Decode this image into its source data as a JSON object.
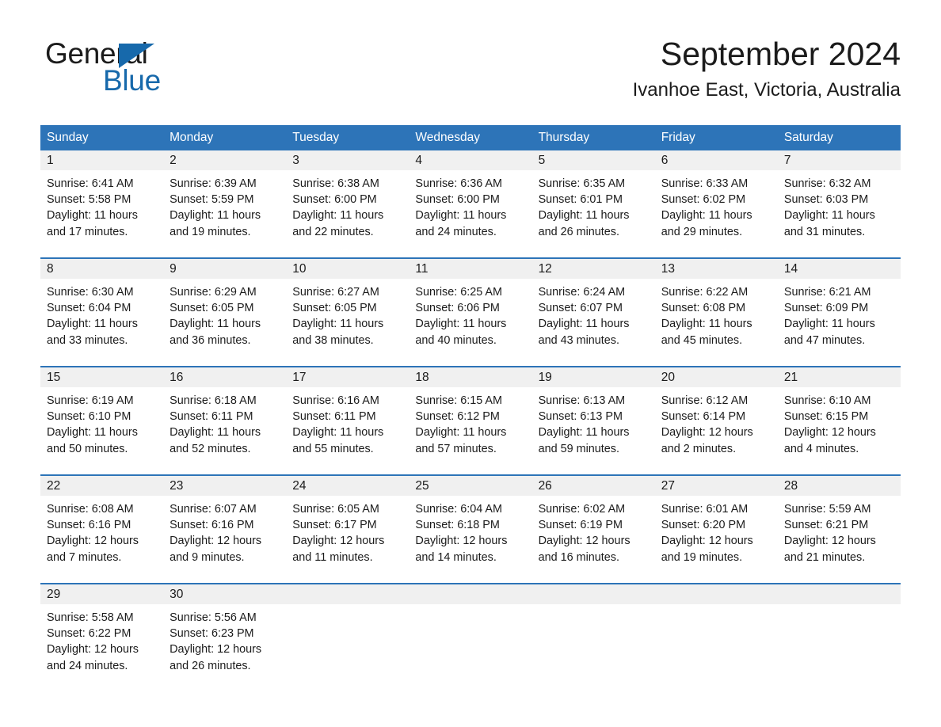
{
  "brand": {
    "name_part1": "General",
    "name_part2": "Blue",
    "triangle_icon": "triangle-logo-icon",
    "accent_color": "#1769ab"
  },
  "header": {
    "title": "September 2024",
    "subtitle": "Ivanhoe East, Victoria, Australia"
  },
  "calendar": {
    "header_color": "#2d74b8",
    "day_number_band_color": "#f0f0f0",
    "weekdays": [
      "Sunday",
      "Monday",
      "Tuesday",
      "Wednesday",
      "Thursday",
      "Friday",
      "Saturday"
    ],
    "weeks": [
      [
        {
          "day": "1",
          "sunrise": "Sunrise: 6:41 AM",
          "sunset": "Sunset: 5:58 PM",
          "daylight": "Daylight: 11 hours and 17 minutes."
        },
        {
          "day": "2",
          "sunrise": "Sunrise: 6:39 AM",
          "sunset": "Sunset: 5:59 PM",
          "daylight": "Daylight: 11 hours and 19 minutes."
        },
        {
          "day": "3",
          "sunrise": "Sunrise: 6:38 AM",
          "sunset": "Sunset: 6:00 PM",
          "daylight": "Daylight: 11 hours and 22 minutes."
        },
        {
          "day": "4",
          "sunrise": "Sunrise: 6:36 AM",
          "sunset": "Sunset: 6:00 PM",
          "daylight": "Daylight: 11 hours and 24 minutes."
        },
        {
          "day": "5",
          "sunrise": "Sunrise: 6:35 AM",
          "sunset": "Sunset: 6:01 PM",
          "daylight": "Daylight: 11 hours and 26 minutes."
        },
        {
          "day": "6",
          "sunrise": "Sunrise: 6:33 AM",
          "sunset": "Sunset: 6:02 PM",
          "daylight": "Daylight: 11 hours and 29 minutes."
        },
        {
          "day": "7",
          "sunrise": "Sunrise: 6:32 AM",
          "sunset": "Sunset: 6:03 PM",
          "daylight": "Daylight: 11 hours and 31 minutes."
        }
      ],
      [
        {
          "day": "8",
          "sunrise": "Sunrise: 6:30 AM",
          "sunset": "Sunset: 6:04 PM",
          "daylight": "Daylight: 11 hours and 33 minutes."
        },
        {
          "day": "9",
          "sunrise": "Sunrise: 6:29 AM",
          "sunset": "Sunset: 6:05 PM",
          "daylight": "Daylight: 11 hours and 36 minutes."
        },
        {
          "day": "10",
          "sunrise": "Sunrise: 6:27 AM",
          "sunset": "Sunset: 6:05 PM",
          "daylight": "Daylight: 11 hours and 38 minutes."
        },
        {
          "day": "11",
          "sunrise": "Sunrise: 6:25 AM",
          "sunset": "Sunset: 6:06 PM",
          "daylight": "Daylight: 11 hours and 40 minutes."
        },
        {
          "day": "12",
          "sunrise": "Sunrise: 6:24 AM",
          "sunset": "Sunset: 6:07 PM",
          "daylight": "Daylight: 11 hours and 43 minutes."
        },
        {
          "day": "13",
          "sunrise": "Sunrise: 6:22 AM",
          "sunset": "Sunset: 6:08 PM",
          "daylight": "Daylight: 11 hours and 45 minutes."
        },
        {
          "day": "14",
          "sunrise": "Sunrise: 6:21 AM",
          "sunset": "Sunset: 6:09 PM",
          "daylight": "Daylight: 11 hours and 47 minutes."
        }
      ],
      [
        {
          "day": "15",
          "sunrise": "Sunrise: 6:19 AM",
          "sunset": "Sunset: 6:10 PM",
          "daylight": "Daylight: 11 hours and 50 minutes."
        },
        {
          "day": "16",
          "sunrise": "Sunrise: 6:18 AM",
          "sunset": "Sunset: 6:11 PM",
          "daylight": "Daylight: 11 hours and 52 minutes."
        },
        {
          "day": "17",
          "sunrise": "Sunrise: 6:16 AM",
          "sunset": "Sunset: 6:11 PM",
          "daylight": "Daylight: 11 hours and 55 minutes."
        },
        {
          "day": "18",
          "sunrise": "Sunrise: 6:15 AM",
          "sunset": "Sunset: 6:12 PM",
          "daylight": "Daylight: 11 hours and 57 minutes."
        },
        {
          "day": "19",
          "sunrise": "Sunrise: 6:13 AM",
          "sunset": "Sunset: 6:13 PM",
          "daylight": "Daylight: 11 hours and 59 minutes."
        },
        {
          "day": "20",
          "sunrise": "Sunrise: 6:12 AM",
          "sunset": "Sunset: 6:14 PM",
          "daylight": "Daylight: 12 hours and 2 minutes."
        },
        {
          "day": "21",
          "sunrise": "Sunrise: 6:10 AM",
          "sunset": "Sunset: 6:15 PM",
          "daylight": "Daylight: 12 hours and 4 minutes."
        }
      ],
      [
        {
          "day": "22",
          "sunrise": "Sunrise: 6:08 AM",
          "sunset": "Sunset: 6:16 PM",
          "daylight": "Daylight: 12 hours and 7 minutes."
        },
        {
          "day": "23",
          "sunrise": "Sunrise: 6:07 AM",
          "sunset": "Sunset: 6:16 PM",
          "daylight": "Daylight: 12 hours and 9 minutes."
        },
        {
          "day": "24",
          "sunrise": "Sunrise: 6:05 AM",
          "sunset": "Sunset: 6:17 PM",
          "daylight": "Daylight: 12 hours and 11 minutes."
        },
        {
          "day": "25",
          "sunrise": "Sunrise: 6:04 AM",
          "sunset": "Sunset: 6:18 PM",
          "daylight": "Daylight: 12 hours and 14 minutes."
        },
        {
          "day": "26",
          "sunrise": "Sunrise: 6:02 AM",
          "sunset": "Sunset: 6:19 PM",
          "daylight": "Daylight: 12 hours and 16 minutes."
        },
        {
          "day": "27",
          "sunrise": "Sunrise: 6:01 AM",
          "sunset": "Sunset: 6:20 PM",
          "daylight": "Daylight: 12 hours and 19 minutes."
        },
        {
          "day": "28",
          "sunrise": "Sunrise: 5:59 AM",
          "sunset": "Sunset: 6:21 PM",
          "daylight": "Daylight: 12 hours and 21 minutes."
        }
      ],
      [
        {
          "day": "29",
          "sunrise": "Sunrise: 5:58 AM",
          "sunset": "Sunset: 6:22 PM",
          "daylight": "Daylight: 12 hours and 24 minutes."
        },
        {
          "day": "30",
          "sunrise": "Sunrise: 5:56 AM",
          "sunset": "Sunset: 6:23 PM",
          "daylight": "Daylight: 12 hours and 26 minutes."
        },
        {
          "day": "",
          "sunrise": "",
          "sunset": "",
          "daylight": ""
        },
        {
          "day": "",
          "sunrise": "",
          "sunset": "",
          "daylight": ""
        },
        {
          "day": "",
          "sunrise": "",
          "sunset": "",
          "daylight": ""
        },
        {
          "day": "",
          "sunrise": "",
          "sunset": "",
          "daylight": ""
        },
        {
          "day": "",
          "sunrise": "",
          "sunset": "",
          "daylight": ""
        }
      ]
    ]
  }
}
